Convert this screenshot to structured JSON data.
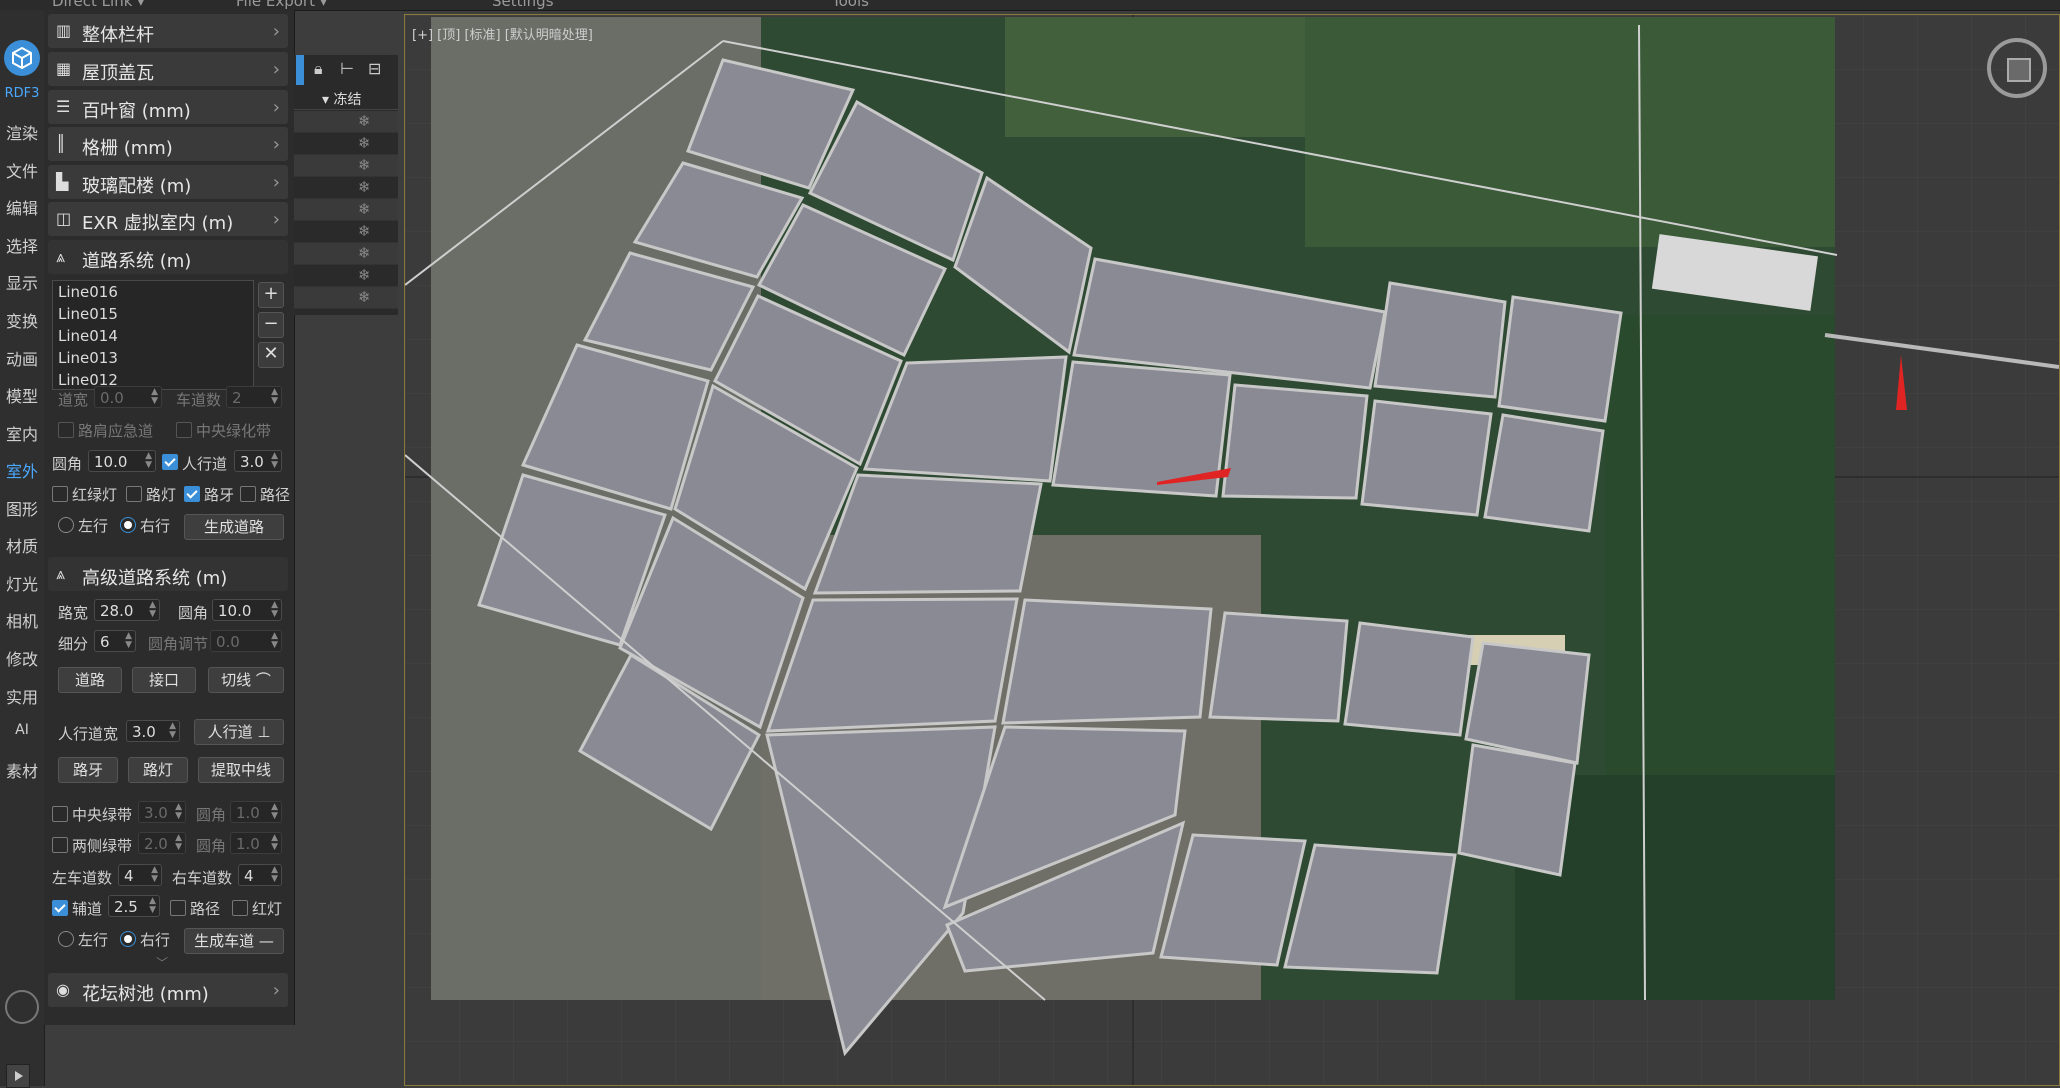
{
  "topbar": {
    "items": [
      "Direct Link ▾",
      "File Export ▾",
      "Settings",
      "Tools"
    ]
  },
  "strip": {
    "rdf": "RDF3",
    "items": [
      "渲染",
      "文件",
      "编辑",
      "选择",
      "显示",
      "变换",
      "动画",
      "模型",
      "室内",
      "室外",
      "图形",
      "材质",
      "灯光",
      "相机",
      "修改",
      "实用",
      "AI",
      "素材"
    ],
    "active": "室外"
  },
  "sections": {
    "s1": "整体栏杆",
    "s2": "屋顶盖瓦",
    "s3": "百叶窗 (mm)",
    "s4": "格栅 (mm)",
    "s5": "玻璃配楼 (m)",
    "s6": "EXR 虚拟室内 (m)",
    "road": "道路系统 (m)",
    "adv": "高级道路系统 (m)",
    "flower": "花坛树池 (mm)"
  },
  "road": {
    "lines": [
      "Line016",
      "Line015",
      "Line014",
      "Line013",
      "Line012"
    ],
    "add": "+",
    "remove": "−",
    "delete": "✕",
    "road_width_label": "道宽",
    "road_width": "0.0",
    "lanes_label": "车道数",
    "lanes": "2",
    "shoulder": "路肩应急道",
    "median": "中央绿化带",
    "corner_label": "圆角",
    "corner": "10.0",
    "sidewalk_label": "人行道",
    "sidewalk": "3.0",
    "traffic_light": "红绿灯",
    "street_light": "路灯",
    "curb": "路牙",
    "path": "路径",
    "left_drive": "左行",
    "right_drive": "右行",
    "generate": "生成道路"
  },
  "adv": {
    "width_label": "路宽",
    "width": "28.0",
    "corner_label": "圆角",
    "corner": "10.0",
    "subdiv_label": "细分",
    "subdiv": "6",
    "corner_adjust_label": "圆角调节",
    "corner_adjust": "0.0",
    "road_btn": "道路",
    "joint_btn": "接口",
    "tangent_btn": "切线",
    "sidewalk_width_label": "人行道宽",
    "sidewalk_width": "3.0",
    "sidewalk_btn": "人行道",
    "curb_btn": "路牙",
    "lamp_btn": "路灯",
    "centerline_btn": "提取中线",
    "median_label": "中央绿带",
    "median_val": "3.0",
    "median_corner_label": "圆角",
    "median_corner": "1.0",
    "side_label": "两侧绿带",
    "side_val": "2.0",
    "side_corner_label": "圆角",
    "side_corner": "1.0",
    "left_lanes_label": "左车道数",
    "left_lanes": "4",
    "right_lanes_label": "右车道数",
    "right_lanes": "4",
    "aux_label": "辅道",
    "aux": "2.5",
    "path_label": "路径",
    "light_label": "红灯",
    "left_drive": "左行",
    "right_drive": "右行",
    "generate": "生成车道"
  },
  "layers": {
    "freeze": "冻结",
    "snow": "❄"
  },
  "viewport": {
    "label": "[+] [顶] [标准] [默认明暗处理]"
  },
  "colors": {
    "accent": "#3a8fd8",
    "block": "#8a8a94",
    "arrow": "#e02424"
  }
}
